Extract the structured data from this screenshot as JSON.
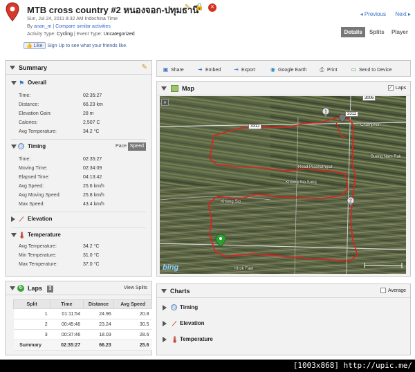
{
  "header": {
    "title": "MTB cross country #2 หนองจอก-ปทุมธานี",
    "datetime": "Sun, Jul 24, 2011 8:32 AM Indochina Time",
    "by_label": "By",
    "author": "anan_m",
    "separator": "|",
    "compare_link": "Compare similar activities",
    "activity_type_label": "Activity Type:",
    "activity_type": "Cycling",
    "event_type_label": "Event Type:",
    "event_type": "Uncategorized",
    "fb_like": "Like",
    "fb_text": "Sign Up to see what your friends like.",
    "prev": "Previous",
    "next": "Next",
    "tabs": [
      "Details",
      "Splits",
      "Player"
    ]
  },
  "summary": {
    "title": "Summary",
    "overall": {
      "title": "Overall",
      "rows": [
        {
          "label": "Time:",
          "value": "02:35:27"
        },
        {
          "label": "Distance:",
          "value": "66.23 km"
        },
        {
          "label": "Elevation Gain:",
          "value": "28 m"
        },
        {
          "label": "Calories:",
          "value": "2,507 C"
        },
        {
          "label": "Avg Temperature:",
          "value": "34.2 °C"
        }
      ]
    },
    "timing": {
      "title": "Timing",
      "pace": "Pace",
      "speed": "Speed",
      "rows": [
        {
          "label": "Time:",
          "value": "02:35:27"
        },
        {
          "label": "Moving Time:",
          "value": "02:34:09"
        },
        {
          "label": "Elapsed Time:",
          "value": "04:13:42"
        },
        {
          "label": "Avg Speed:",
          "value": "25.6 km/h"
        },
        {
          "label": "Avg Moving Speed:",
          "value": "25.8 km/h"
        },
        {
          "label": "Max Speed:",
          "value": "43.4 km/h"
        }
      ]
    },
    "elevation": {
      "title": "Elevation"
    },
    "temperature": {
      "title": "Temperature",
      "rows": [
        {
          "label": "Avg Temperature:",
          "value": "34.2 °C"
        },
        {
          "label": "Min Temperature:",
          "value": "31.0 °C"
        },
        {
          "label": "Max Temperature:",
          "value": "37.0 °C"
        }
      ]
    }
  },
  "laps": {
    "title": "Laps",
    "count": "3",
    "view_splits": "View Splits",
    "columns": [
      "Split",
      "Time",
      "Distance",
      "Avg Speed"
    ],
    "rows": [
      [
        "1",
        "01:11:54",
        "24.96",
        "20.8"
      ],
      [
        "2",
        "00:45:46",
        "23.24",
        "30.5"
      ],
      [
        "3",
        "00:37:46",
        "18.03",
        "28.6"
      ]
    ],
    "summary": [
      "Summary",
      "02:35:27",
      "66.23",
      "25.6"
    ]
  },
  "toolbar": {
    "share": "Share",
    "embed": "Embed",
    "export": "Export",
    "google_earth": "Google Earth",
    "print": "Print",
    "send_to_device": "Send to Device"
  },
  "map": {
    "title": "Map",
    "laps_label": "Laps",
    "labels": {
      "chumphon": "Chumphon",
      "bueng_nam_rak": "Bueng Nam Rak",
      "road_prachathipat": "Road Prachathipat",
      "khlong_sip_song": "Khlong Sip Song",
      "khlong_sip": "Khlong Sip",
      "khok_faet": "Khok Faet",
      "road_3312": "3312",
      "road_3006": "3006"
    },
    "logo": "bing",
    "markers": [
      "1",
      "2"
    ]
  },
  "charts": {
    "title": "Charts",
    "average_label": "Average",
    "items": [
      "Timing",
      "Elevation",
      "Temperature"
    ]
  },
  "watermark": "[1003x868] http://upic.me/",
  "colors": {
    "route": "#e0201c",
    "link": "#3366cc",
    "tab_active": "#777777"
  }
}
